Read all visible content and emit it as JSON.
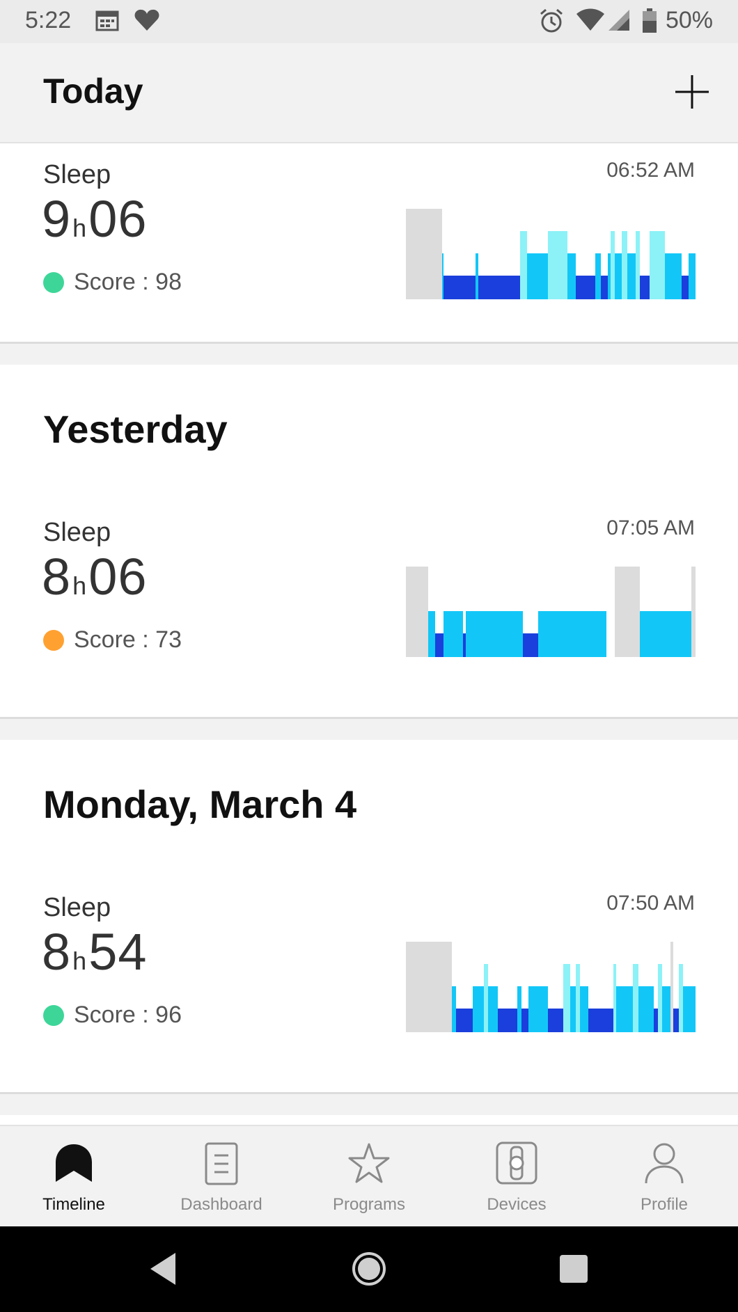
{
  "status_bar": {
    "time": "5:22",
    "battery": "50%",
    "icons": [
      "calendar-icon",
      "heart-icon",
      "alarm-icon",
      "wifi-icon",
      "signal-icon",
      "battery-icon"
    ]
  },
  "header": {
    "title": "Today",
    "add_icon": "plus-icon"
  },
  "entries": [
    {
      "day": "Today",
      "label": "Sleep",
      "hours": "9",
      "h_unit": "h",
      "minutes": "06",
      "score_text": "Score : 98",
      "score_color": "#3dd698",
      "end_time": "06:52 AM"
    },
    {
      "day": "Yesterday",
      "label": "Sleep",
      "hours": "8",
      "h_unit": "h",
      "minutes": "06",
      "score_text": "Score : 73",
      "score_color": "#ffa131",
      "end_time": "07:05 AM"
    },
    {
      "day": "Monday, March 4",
      "label": "Sleep",
      "hours": "8",
      "h_unit": "h",
      "minutes": "54",
      "score_text": "Score : 96",
      "score_color": "#3dd698",
      "end_time": "07:50 AM"
    }
  ],
  "colors": {
    "awake": "#dcdcdc",
    "light": "#12c7f7",
    "rem": "#8cf2f7",
    "deep": "#1b3fdc"
  },
  "nav": {
    "items": [
      {
        "label": "Timeline",
        "icon": "timeline-icon",
        "active": true
      },
      {
        "label": "Dashboard",
        "icon": "dashboard-icon",
        "active": false
      },
      {
        "label": "Programs",
        "icon": "star-icon",
        "active": false
      },
      {
        "label": "Devices",
        "icon": "watch-icon",
        "active": false
      },
      {
        "label": "Profile",
        "icon": "person-icon",
        "active": false
      }
    ]
  },
  "system_nav": [
    "back-icon",
    "home-icon",
    "recents-icon"
  ]
}
